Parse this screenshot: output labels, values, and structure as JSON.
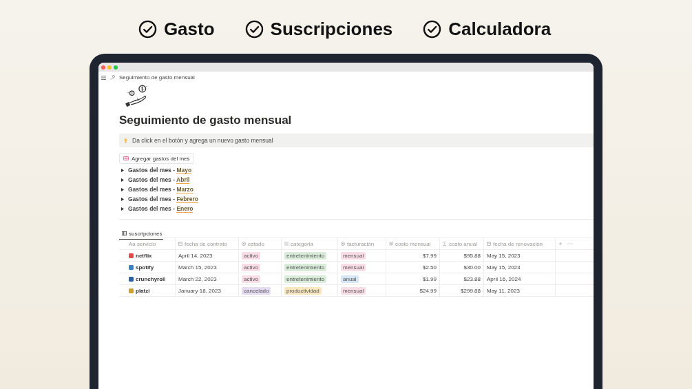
{
  "headline": [
    {
      "label": "Gasto"
    },
    {
      "label": "Suscripciones"
    },
    {
      "label": "Calculadora"
    }
  ],
  "breadcrumb": "Seguimiento de gasto mensual",
  "title": "Seguimiento de gasto mensual",
  "callout": "Da click en el botón y agrega un nuevo gasto mensual",
  "add_button": "Agregar gastos del mes",
  "toggles": [
    {
      "label": "Gastos del mes - ",
      "month": "Mayo"
    },
    {
      "label": "Gastos del mes - ",
      "month": "Abril"
    },
    {
      "label": "Gastos del mes - ",
      "month": "Marzo"
    },
    {
      "label": "Gastos del mes - ",
      "month": "Febrero"
    },
    {
      "label": "Gastos del mes - ",
      "month": "Enero"
    }
  ],
  "table": {
    "tab": "suscripciones",
    "columns": [
      {
        "label": "Aa servicio",
        "kind": "title"
      },
      {
        "label": "fecha de contrato",
        "kind": "date"
      },
      {
        "label": "estado",
        "kind": "status"
      },
      {
        "label": "categoria",
        "kind": "list"
      },
      {
        "label": "facturación",
        "kind": "status"
      },
      {
        "label": "costo mensual",
        "kind": "number"
      },
      {
        "label": "costo anual",
        "kind": "formula"
      },
      {
        "label": "fecha de renovación",
        "kind": "date"
      }
    ],
    "rows": [
      {
        "service": "netflix",
        "color": "#e5484d",
        "date": "April 14, 2023",
        "estado": {
          "label": "activo",
          "color": "#f9dde6"
        },
        "categoria": {
          "label": "entretenimiento",
          "color": "#d9ecd9"
        },
        "facturacion": {
          "label": "mensual",
          "color": "#f9dde6"
        },
        "monthly": "$7.99",
        "annual": "$95.88",
        "renewal": "May 15, 2023"
      },
      {
        "service": "spotify",
        "color": "#3b82c4",
        "date": "March 15, 2023",
        "estado": {
          "label": "activo",
          "color": "#f9dde6"
        },
        "categoria": {
          "label": "entretenimiento",
          "color": "#d9ecd9"
        },
        "facturacion": {
          "label": "mensual",
          "color": "#f9dde6"
        },
        "monthly": "$2.50",
        "annual": "$30.00",
        "renewal": "May 15, 2023"
      },
      {
        "service": "crunchyroll",
        "color": "#2f5fa8",
        "date": "March 22, 2023",
        "estado": {
          "label": "activo",
          "color": "#f9dde6"
        },
        "categoria": {
          "label": "entretenimiento",
          "color": "#d9ecd9"
        },
        "facturacion": {
          "label": "anual",
          "color": "#d6e6f5"
        },
        "monthly": "$1.99",
        "annual": "$23.88",
        "renewal": "April 16, 2024"
      },
      {
        "service": "platzi",
        "color": "#c9a227",
        "date": "January 18, 2023",
        "estado": {
          "label": "cancelado",
          "color": "#e6dcf2"
        },
        "categoria": {
          "label": "productividad",
          "color": "#f7e6c0"
        },
        "facturacion": {
          "label": "mensual",
          "color": "#f9dde6"
        },
        "monthly": "$24.99",
        "annual": "$299.88",
        "renewal": "May 11, 2023"
      }
    ]
  }
}
